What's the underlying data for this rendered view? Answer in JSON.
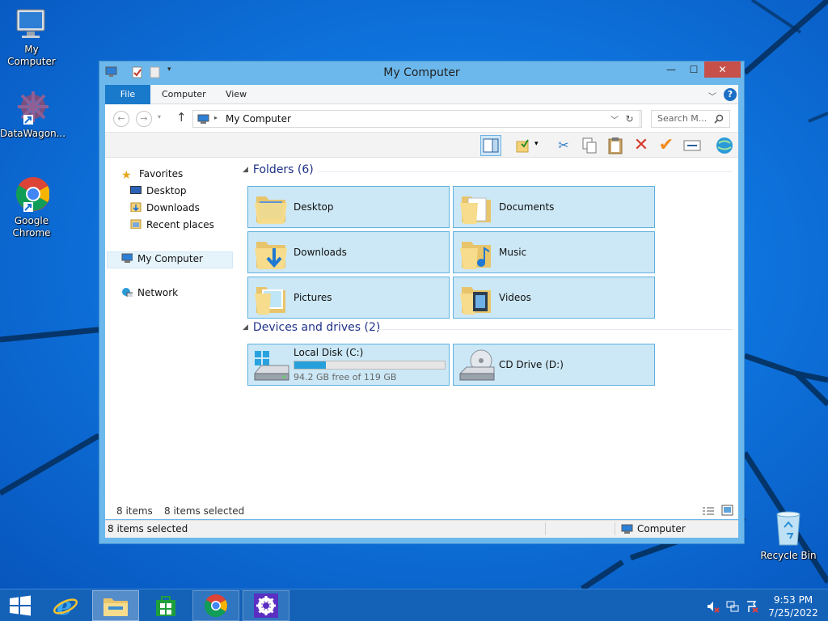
{
  "desktop": {
    "icons": [
      {
        "label": "My Computer"
      },
      {
        "label": "DataWagon..."
      },
      {
        "label": "Google Chrome"
      },
      {
        "label": "Recycle Bin"
      }
    ]
  },
  "window": {
    "title": "My Computer",
    "controls": {
      "minimize": "—",
      "maximize": "☐",
      "close": "✕"
    }
  },
  "ribbon": {
    "tabs": [
      "File",
      "Computer",
      "View"
    ],
    "help": "?"
  },
  "navbar": {
    "address": "My Computer",
    "search_placeholder": "Search M..."
  },
  "navpane": {
    "favorites": "Favorites",
    "favorites_items": [
      "Desktop",
      "Downloads",
      "Recent places"
    ],
    "my_computer": "My Computer",
    "network": "Network"
  },
  "groups": {
    "folders": {
      "title": "Folders (6)",
      "items": [
        "Desktop",
        "Documents",
        "Downloads",
        "Music",
        "Pictures",
        "Videos"
      ]
    },
    "drives": {
      "title": "Devices and drives (2)"
    }
  },
  "drives": [
    {
      "name": "Local Disk (C:)",
      "free_text": "94.2 GB free of 119 GB",
      "used_fraction": 0.21
    },
    {
      "name": "CD Drive (D:)"
    }
  ],
  "status": {
    "items_count": "8 items",
    "items_selected": "8 items selected",
    "bottom_selected": "8 items selected",
    "bottom_location": "Computer"
  },
  "taskbar": {
    "time": "9:53 PM",
    "date": "7/25/2022"
  }
}
